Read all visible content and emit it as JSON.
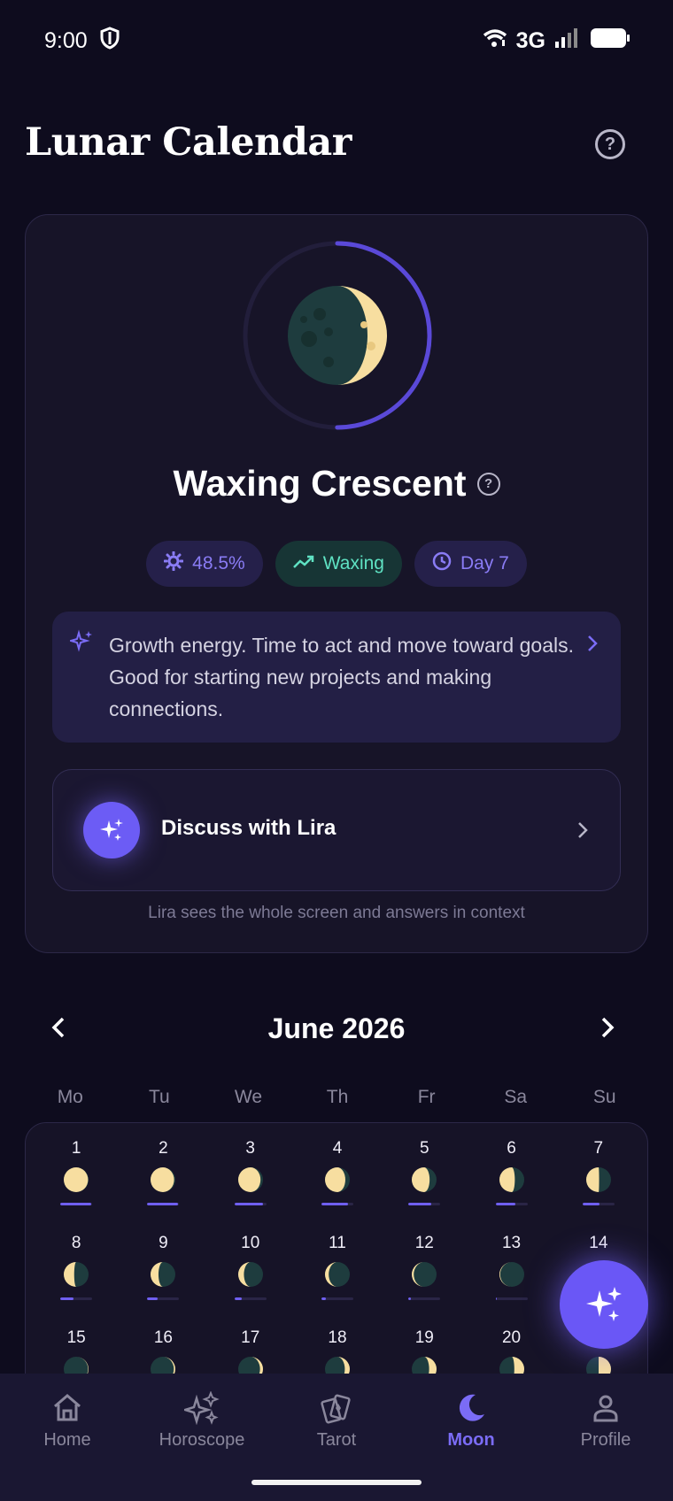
{
  "status_bar": {
    "time": "9:00",
    "network": "3G"
  },
  "header": {
    "title": "Lunar Calendar"
  },
  "phase": {
    "name": "Waxing Crescent",
    "cycle_progress": 0.5,
    "chips": {
      "illumination": "48.5%",
      "trend": "Waxing",
      "day": "Day 7"
    },
    "energy_text": "Growth energy. Time to act and move toward goals. Good for starting new projects and making connections.",
    "discuss_label": "Discuss with Lira",
    "lira_note": "Lira sees the whole screen and answers in context"
  },
  "calendar": {
    "month": "June 2026",
    "weekdays": [
      "Mo",
      "Tu",
      "We",
      "Th",
      "Fr",
      "Sa",
      "Su"
    ],
    "days": [
      {
        "n": "1",
        "lit": 0.98,
        "waning": true
      },
      {
        "n": "2",
        "lit": 0.95,
        "waning": true
      },
      {
        "n": "3",
        "lit": 0.9,
        "waning": true
      },
      {
        "n": "4",
        "lit": 0.82,
        "waning": true
      },
      {
        "n": "5",
        "lit": 0.72,
        "waning": true
      },
      {
        "n": "6",
        "lit": 0.62,
        "waning": true
      },
      {
        "n": "7",
        "lit": 0.52,
        "waning": true
      },
      {
        "n": "8",
        "lit": 0.42,
        "waning": true
      },
      {
        "n": "9",
        "lit": 0.32,
        "waning": true
      },
      {
        "n": "10",
        "lit": 0.23,
        "waning": true
      },
      {
        "n": "11",
        "lit": 0.15,
        "waning": true
      },
      {
        "n": "12",
        "lit": 0.08,
        "waning": true
      },
      {
        "n": "13",
        "lit": 0.03,
        "waning": true
      },
      {
        "n": "14",
        "lit": 0.0,
        "waning": true
      },
      {
        "n": "15",
        "lit": 0.02,
        "waning": false
      },
      {
        "n": "16",
        "lit": 0.06,
        "waning": false
      },
      {
        "n": "17",
        "lit": 0.12,
        "waning": false
      },
      {
        "n": "18",
        "lit": 0.2,
        "waning": false
      },
      {
        "n": "19",
        "lit": 0.3,
        "waning": false
      },
      {
        "n": "20",
        "lit": 0.4,
        "waning": false
      },
      {
        "n": "21",
        "lit": 0.5,
        "waning": false
      }
    ]
  },
  "tabs": [
    {
      "label": "Home",
      "icon": "home-icon",
      "active": false
    },
    {
      "label": "Horoscope",
      "icon": "sparkles-icon",
      "active": false
    },
    {
      "label": "Tarot",
      "icon": "tarot-cards-icon",
      "active": false
    },
    {
      "label": "Moon",
      "icon": "moon-icon",
      "active": true
    },
    {
      "label": "Profile",
      "icon": "profile-icon",
      "active": false
    }
  ],
  "colors": {
    "accent": "#6c5cf5",
    "teal": "#5fe2c3",
    "background": "#0e0c1e"
  }
}
